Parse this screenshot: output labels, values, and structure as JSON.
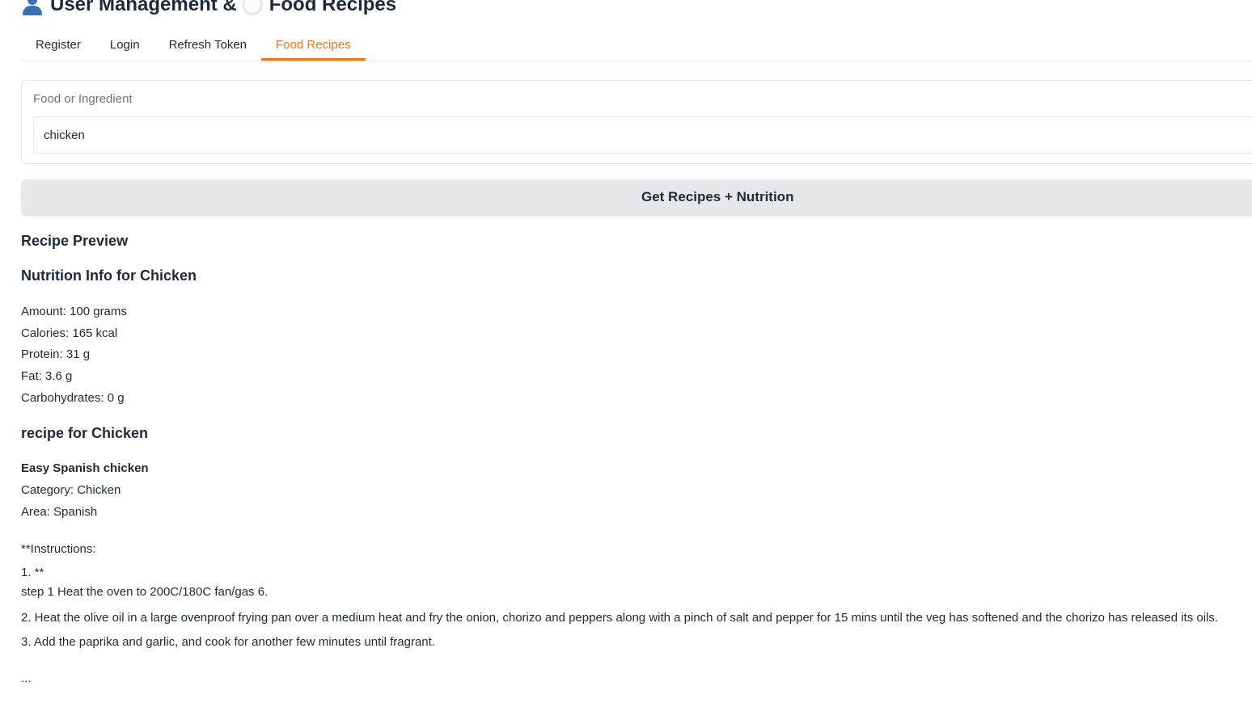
{
  "app": {
    "title_part1": "User Management &",
    "title_part2": "Food Recipes",
    "title_icons": [
      "user-icon",
      "plate-icon"
    ]
  },
  "tabs": [
    {
      "label": "Register",
      "active": false
    },
    {
      "label": "Login",
      "active": false
    },
    {
      "label": "Refresh Token",
      "active": false
    },
    {
      "label": "Food Recipes",
      "active": true
    }
  ],
  "form": {
    "label": "Food or Ingredient",
    "value": "chicken",
    "button_label": "Get Recipes + Nutrition"
  },
  "output": {
    "preview_heading": "Recipe Preview",
    "nutrition_heading": "Nutrition Info for Chicken",
    "nutrition": [
      "Amount: 100 grams",
      "Calories: 165 kcal",
      "Protein: 31 g",
      "Fat: 3.6 g",
      "Carbohydrates: 0 g"
    ],
    "recipe_heading": "recipe for Chicken",
    "recipe_name": "Easy Spanish chicken",
    "category": "Category: Chicken",
    "area": "Area: Spanish",
    "instructions_label": "**Instructions:",
    "step1_marker": "1. **",
    "steps": [
      "step 1 Heat the oven to 200C/180C fan/gas 6.",
      "2. Heat the olive oil in a large ovenproof frying pan over a medium heat and fry the onion, chorizo and peppers along with a pinch of salt and pepper for 15 mins until the veg has softened and the chorizo has released its oils.",
      "3. Add the paprika and garlic, and cook for another few minutes until fragrant."
    ],
    "ellipsis": "..."
  },
  "colors": {
    "accent": "#f97316",
    "border": "#e5e7eb",
    "button_bg": "#e5e7eb",
    "text": "#1f2937",
    "muted": "#6b7280"
  }
}
